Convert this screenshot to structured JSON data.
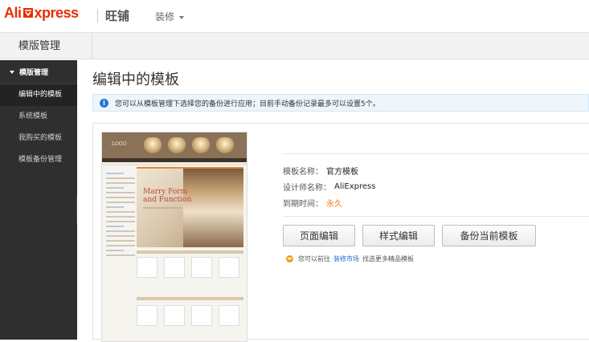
{
  "topbar": {
    "logo_ali": "Ali",
    "logo_rest": "xpress",
    "brand": "旺铺",
    "decorate": "装修"
  },
  "strip": {
    "title": "模版管理"
  },
  "sidebar": {
    "header": "模版管理",
    "items": [
      {
        "label": "编辑中的模板"
      },
      {
        "label": "系统模板"
      },
      {
        "label": "我购买的模板"
      },
      {
        "label": "模板备份管理"
      }
    ]
  },
  "main": {
    "title": "编辑中的模板",
    "notice": "您可以从模板管理下选择您的备份进行应用；目前手动备份记录最多可以设置5个。",
    "thumbnail": {
      "logo": "LOGO",
      "hero_title_1": "Marry Form",
      "hero_title_2": "and Function"
    },
    "info": {
      "name_label": "模板名称：",
      "name_value": "官方模板",
      "designer_label": "设计师名称：",
      "designer_value": "AliExpress",
      "expire_label": "到期时间：",
      "expire_value": "永久"
    },
    "buttons": {
      "edit_page": "页面编辑",
      "edit_style": "样式编辑",
      "backup": "备份当前模板"
    },
    "tip": {
      "prefix": "您可以前往",
      "link": "装修市场",
      "suffix": "找选更多精品模板"
    }
  },
  "colors": {
    "brand_red": "#e62e04",
    "sidebar_bg": "#2f2f2f",
    "link_blue": "#1e6fc8",
    "orange": "#f07a12"
  }
}
